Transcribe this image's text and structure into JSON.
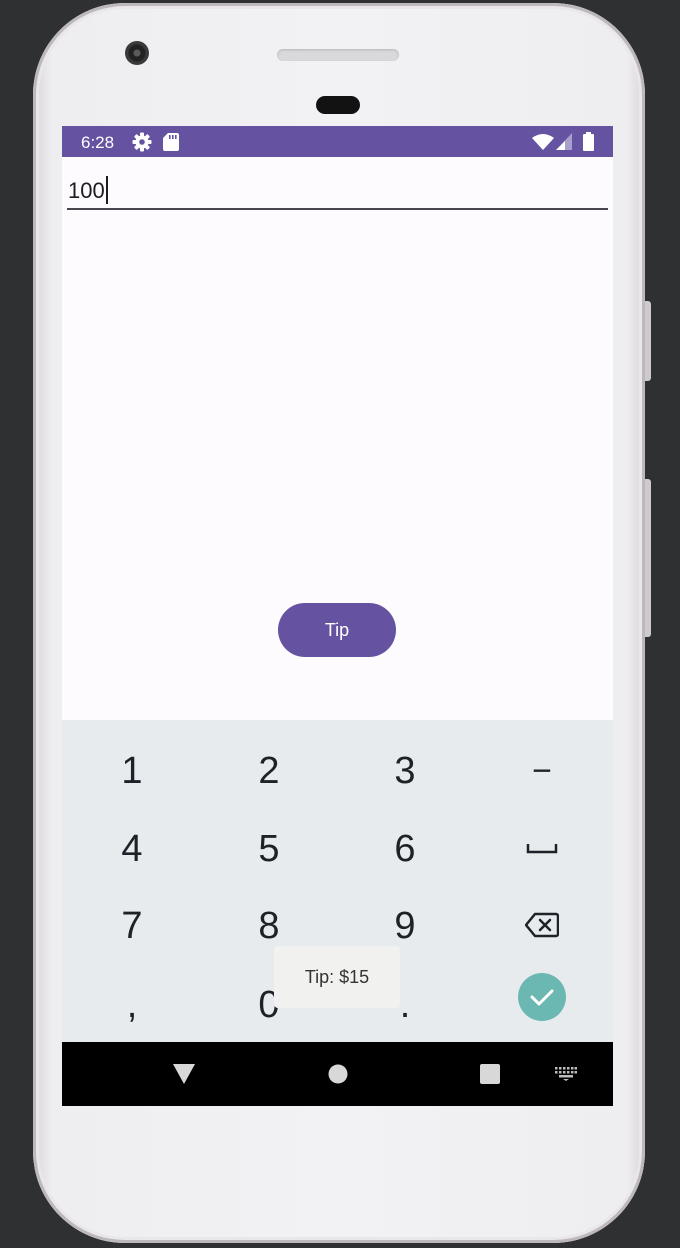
{
  "status_bar": {
    "time": "6:28",
    "left_icons": [
      "gear-icon",
      "sd-card-icon"
    ],
    "right_icons": [
      "wifi-icon",
      "signal-icon",
      "battery-icon"
    ],
    "color": "#6553a2"
  },
  "input": {
    "value": "100"
  },
  "tip_button": {
    "label": "Tip",
    "color": "#6553a2"
  },
  "keyboard": {
    "rows": [
      [
        "1",
        "2",
        "3",
        "−"
      ],
      [
        "4",
        "5",
        "6",
        "space-icon"
      ],
      [
        "7",
        "8",
        "9",
        "backspace-icon"
      ],
      [
        ",",
        "0",
        ".",
        "check-icon"
      ]
    ],
    "key_1": "1",
    "key_2": "2",
    "key_3": "3",
    "key_minus": "−",
    "key_4": "4",
    "key_5": "5",
    "key_6": "6",
    "key_7": "7",
    "key_8": "8",
    "key_9": "9",
    "key_comma": ",",
    "key_0": "0",
    "key_dot": ".",
    "done_color": "#6ab8b1"
  },
  "toast": {
    "text": "Tip: $15"
  },
  "nav_bar": {
    "icons": [
      "back-icon",
      "home-icon",
      "recents-icon",
      "keyboard-switch-icon"
    ]
  }
}
